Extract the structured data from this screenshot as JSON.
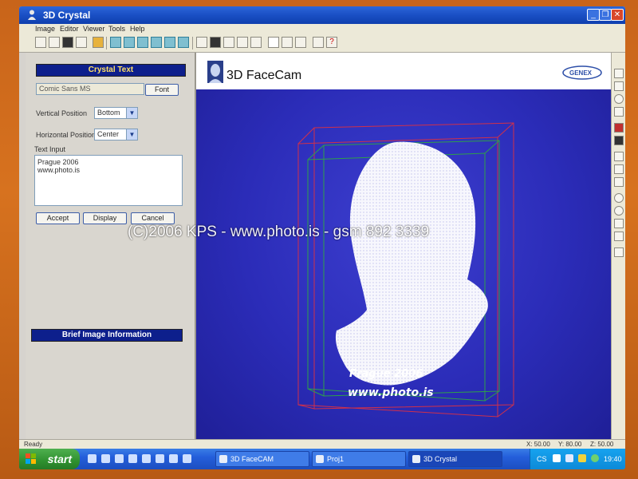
{
  "window": {
    "title": "3D Crystal"
  },
  "menu": [
    "Image",
    "Editor",
    "Viewer",
    "Tools",
    "Help"
  ],
  "left_panel": {
    "header": "Crystal Text",
    "font_value": "Comic Sans MS",
    "font_button": "Font",
    "vertical_label": "Vertical Position",
    "vertical_value": "Bottom",
    "horizontal_label": "Horizontal Position",
    "horizontal_value": "Center",
    "text_input_label": "Text Input",
    "text_input_value": "Prague 2006\nwww.photo.is",
    "accept": "Accept",
    "display": "Display",
    "cancel": "Cancel",
    "info_header": "Brief Image Information"
  },
  "viewport": {
    "brand": "3D FaceCam",
    "logo_text": "GENEX",
    "crystal_line1": "Prague 2006",
    "crystal_line2": "www.photo.is"
  },
  "watermark": "(C)2006 KPS - www.photo.is - gsm 892 3339",
  "status": {
    "ready": "Ready",
    "x": "X: 50.00",
    "y": "Y: 80.00",
    "z": "Z: 50.00"
  },
  "taskbar": {
    "start": "start",
    "tasks": [
      "3D FaceCAM",
      "Proj1",
      "3D Crystal"
    ],
    "lang": "CS",
    "clock": "19:40"
  }
}
